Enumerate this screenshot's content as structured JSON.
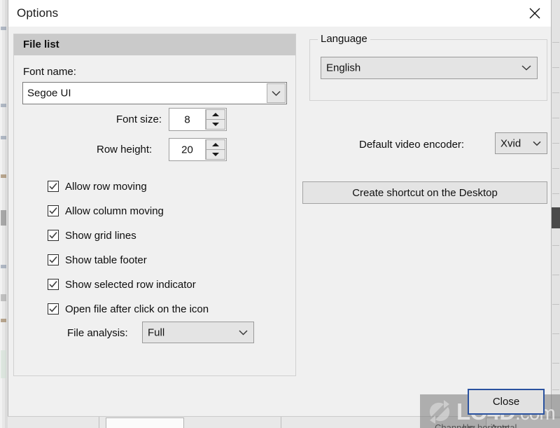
{
  "window": {
    "title": "Options",
    "close_icon": "close-x-icon"
  },
  "file_list": {
    "group_title": "File list",
    "font_name_label": "Font name:",
    "font_name_value": "Segoe UI",
    "font_size_label": "Font size:",
    "font_size_value": "8",
    "row_height_label": "Row height:",
    "row_height_value": "20",
    "checkboxes": [
      {
        "label": "Allow row moving",
        "checked": true
      },
      {
        "label": "Allow column moving",
        "checked": true
      },
      {
        "label": "Show grid lines",
        "checked": true
      },
      {
        "label": "Show table footer",
        "checked": true
      },
      {
        "label": "Show selected row indicator",
        "checked": true
      },
      {
        "label": "Open file after click on the icon",
        "checked": true
      }
    ],
    "file_analysis_label": "File analysis:",
    "file_analysis_value": "Full"
  },
  "language": {
    "group_title": "Language",
    "selected": "English"
  },
  "encoder": {
    "label": "Default video encoder:",
    "selected": "Xvid"
  },
  "actions": {
    "create_shortcut": "Create shortcut on the Desktop",
    "close": "Close"
  },
  "watermark": {
    "text": "LO4D",
    "suffix": ".com"
  },
  "background_window": {
    "bottom_label": "Channels:",
    "bottom_value": "Auto",
    "bottom_right_text": "lue horizontal"
  },
  "colors": {
    "dialog_bg": "#f0f0f0",
    "titlebar_bg": "#ffffff",
    "group_header_bg": "#cacaca",
    "focus_border": "#2a52a0",
    "text": "#0d0d0d"
  }
}
